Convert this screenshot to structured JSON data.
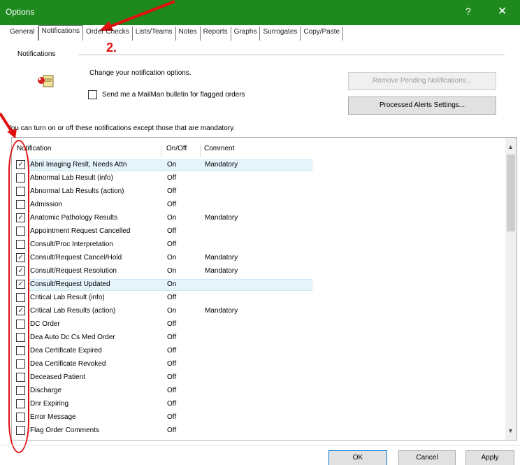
{
  "window": {
    "title": "Options",
    "help_glyph": "?",
    "close_glyph": "✕"
  },
  "tabs": [
    {
      "label": "General"
    },
    {
      "label": "Notifications",
      "active": true
    },
    {
      "label": "Order Checks"
    },
    {
      "label": "Lists/Teams"
    },
    {
      "label": "Notes"
    },
    {
      "label": "Reports"
    },
    {
      "label": "Graphs"
    },
    {
      "label": "Surrogates"
    },
    {
      "label": "Copy/Paste"
    }
  ],
  "annotation": {
    "step_label": "2.",
    "color": "#e01010"
  },
  "notifications_group": {
    "label": "Notifications",
    "description": "Change your notification options.",
    "mailman_label": "Send me a MailMan bulletin for flagged orders",
    "mailman_checked": false,
    "remove_button": "Remove Pending Notifications...",
    "processed_button": "Processed Alerts Settings..."
  },
  "mandatory_note": "You can turn on or off these notifications except those that are mandatory.",
  "list": {
    "columns": {
      "notification": "Notification",
      "onoff": "On/Off",
      "comment": "Comment"
    },
    "rows": [
      {
        "name": "Abnl Imaging Reslt, Needs Attn",
        "checked": true,
        "onoff": "On",
        "comment": "Mandatory",
        "selected": true
      },
      {
        "name": "Abnormal Lab Result (info)",
        "checked": false,
        "onoff": "Off",
        "comment": ""
      },
      {
        "name": "Abnormal Lab Results (action)",
        "checked": false,
        "onoff": "Off",
        "comment": ""
      },
      {
        "name": "Admission",
        "checked": false,
        "onoff": "Off",
        "comment": ""
      },
      {
        "name": "Anatomic Pathology Results",
        "checked": true,
        "onoff": "On",
        "comment": "Mandatory"
      },
      {
        "name": "Appointment Request Cancelled",
        "checked": false,
        "onoff": "Off",
        "comment": ""
      },
      {
        "name": "Consult/Proc Interpretation",
        "checked": false,
        "onoff": "Off",
        "comment": ""
      },
      {
        "name": "Consult/Request Cancel/Hold",
        "checked": true,
        "onoff": "On",
        "comment": "Mandatory"
      },
      {
        "name": "Consult/Request Resolution",
        "checked": true,
        "onoff": "On",
        "comment": "Mandatory"
      },
      {
        "name": "Consult/Request Updated",
        "checked": true,
        "onoff": "On",
        "comment": "",
        "selected": true
      },
      {
        "name": "Critical Lab Result (info)",
        "checked": false,
        "onoff": "Off",
        "comment": ""
      },
      {
        "name": "Critical Lab Results (action)",
        "checked": true,
        "onoff": "On",
        "comment": "Mandatory"
      },
      {
        "name": "DC Order",
        "checked": false,
        "onoff": "Off",
        "comment": ""
      },
      {
        "name": "Dea Auto Dc Cs Med Order",
        "checked": false,
        "onoff": "Off",
        "comment": ""
      },
      {
        "name": "Dea Certificate Expired",
        "checked": false,
        "onoff": "Off",
        "comment": ""
      },
      {
        "name": "Dea Certificate Revoked",
        "checked": false,
        "onoff": "Off",
        "comment": ""
      },
      {
        "name": "Deceased Patient",
        "checked": false,
        "onoff": "Off",
        "comment": ""
      },
      {
        "name": "Discharge",
        "checked": false,
        "onoff": "Off",
        "comment": ""
      },
      {
        "name": "Dnr Expiring",
        "checked": false,
        "onoff": "Off",
        "comment": ""
      },
      {
        "name": "Error Message",
        "checked": false,
        "onoff": "Off",
        "comment": ""
      },
      {
        "name": "Flag Order Comments",
        "checked": false,
        "onoff": "Off",
        "comment": ""
      }
    ],
    "check_glyph": "✓",
    "scroll_up": "▲",
    "scroll_down": "▼"
  },
  "footer": {
    "ok": "OK",
    "cancel": "Cancel",
    "apply": "Apply"
  }
}
